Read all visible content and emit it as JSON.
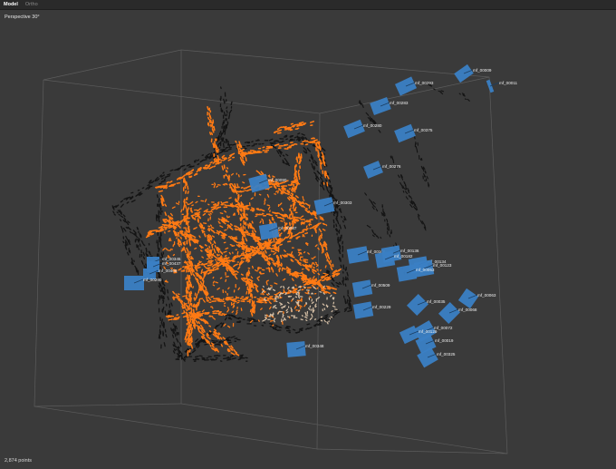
{
  "tabs": [
    {
      "label": "Model",
      "active": true
    },
    {
      "label": "Ortho",
      "active": false
    }
  ],
  "viewport": {
    "view_label": "Perspective 30°",
    "status": "2,874 points"
  },
  "colors": {
    "background": "#3a3a3a",
    "points_primary": "#ff7a14",
    "points_dark": "#141414",
    "points_light": "#d8c2a8",
    "camera": "#3a7fc4",
    "bounding_box": "#5c5c5c"
  },
  "cameras": [
    {
      "label": "mf_00009"
    },
    {
      "label": "mf_00011"
    },
    {
      "label": "mf_00293"
    },
    {
      "label": "mf_00283"
    },
    {
      "label": "mf_00280"
    },
    {
      "label": "mf_00375"
    },
    {
      "label": "mf_00276"
    },
    {
      "label": "mf_00090"
    },
    {
      "label": "mf_00303"
    },
    {
      "label": "mf_00087"
    },
    {
      "label": "mf_00345"
    },
    {
      "label": "mf_00437"
    },
    {
      "label": "mf_00408"
    },
    {
      "label": "mf_00290"
    },
    {
      "label": "mf_00106"
    },
    {
      "label": "mf_00136"
    },
    {
      "label": "mf_00182"
    },
    {
      "label": "mf_00134"
    },
    {
      "label": "mf_00123"
    },
    {
      "label": "mf_00053"
    },
    {
      "label": "mf_00509"
    },
    {
      "label": "mf_00229"
    },
    {
      "label": "mf_00063"
    },
    {
      "label": "mf_00035"
    },
    {
      "label": "mf_00068"
    },
    {
      "label": "mf_00072"
    },
    {
      "label": "mf_00129"
    },
    {
      "label": "mf_00019"
    },
    {
      "label": "mf_00348"
    },
    {
      "label": "mf_00325"
    }
  ]
}
